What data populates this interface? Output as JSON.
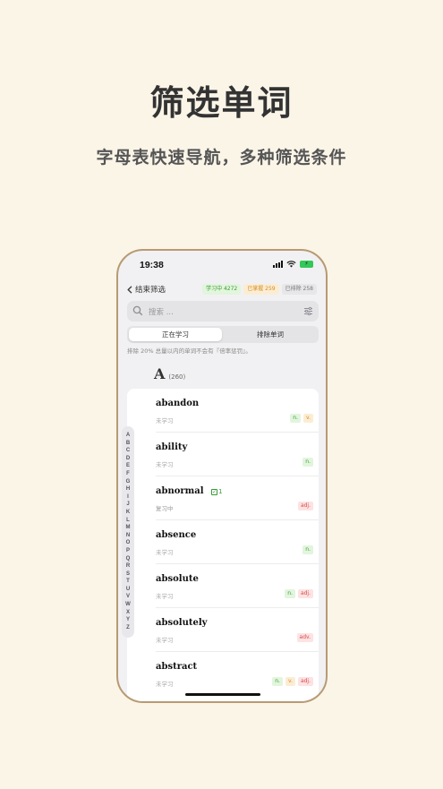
{
  "promo": {
    "title": "筛选单词",
    "subtitle": "字母表快速导航，多种筛选条件"
  },
  "status_bar": {
    "time": "19:38",
    "battery_icon": "battery-charging-icon"
  },
  "nav": {
    "back_label": "结束筛选",
    "badges": {
      "learning": "学习中 4272",
      "mastered": "已掌握 259",
      "excluded": "已排除 258"
    }
  },
  "search": {
    "placeholder": "搜索 ..."
  },
  "segment": {
    "active": "正在学习",
    "inactive": "排除单词"
  },
  "note": "排除 20% 总量以内的单词不会有『倍率惩罚』。",
  "section": {
    "letter": "A",
    "count": "(260)"
  },
  "words": [
    {
      "word": "abandon",
      "status": "未学习",
      "pos": [
        "n.",
        "v."
      ]
    },
    {
      "word": "ability",
      "status": "未学习",
      "pos": [
        "n."
      ]
    },
    {
      "word": "abnormal",
      "status": "复习中",
      "pos": [
        "adj."
      ],
      "check": "1"
    },
    {
      "word": "absence",
      "status": "未学习",
      "pos": [
        "n."
      ]
    },
    {
      "word": "absolute",
      "status": "未学习",
      "pos": [
        "n.",
        "adj."
      ]
    },
    {
      "word": "absolutely",
      "status": "未学习",
      "pos": [
        "adv."
      ]
    },
    {
      "word": "abstract",
      "status": "未学习",
      "pos": [
        "n.",
        "v.",
        "adj."
      ]
    }
  ],
  "alphabet": [
    "A",
    "B",
    "C",
    "D",
    "E",
    "F",
    "G",
    "H",
    "I",
    "J",
    "K",
    "L",
    "M",
    "N",
    "O",
    "P",
    "Q",
    "R",
    "S",
    "T",
    "U",
    "V",
    "W",
    "X",
    "Y",
    "Z"
  ],
  "colors": {
    "background": "#fbf5e8",
    "phone_frame": "#b89a72",
    "learning_green": "#3a9a35",
    "mastered_orange": "#d98c1f",
    "adj_red": "#d94a4a"
  }
}
